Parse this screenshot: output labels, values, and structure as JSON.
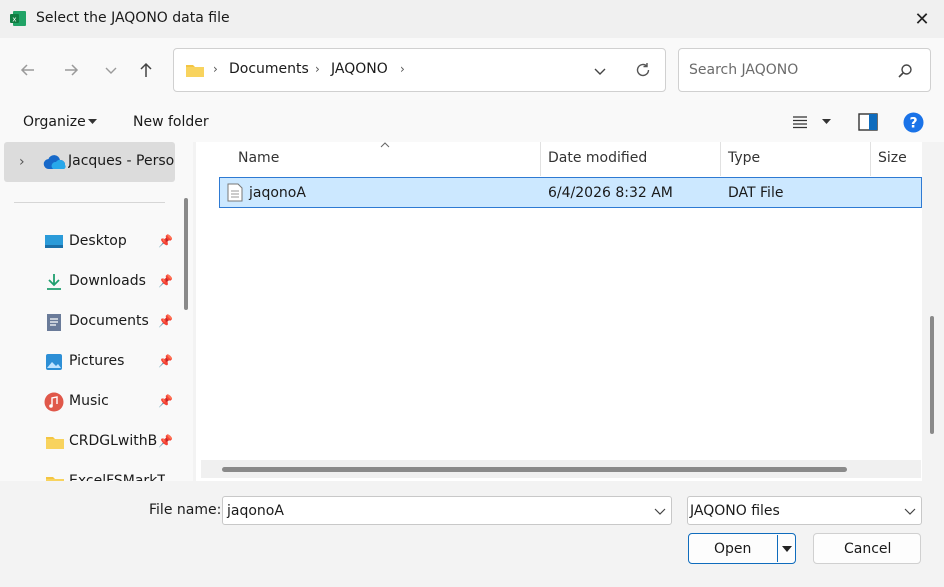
{
  "window": {
    "title": "Select the JAQONO data file",
    "close_symbol": "✕"
  },
  "nav": {
    "breadcrumbs": [
      "Documents",
      "JAQONO"
    ],
    "search_placeholder": "Search JAQONO"
  },
  "toolbar": {
    "organize_label": "Organize",
    "new_folder_label": "New folder"
  },
  "sidebar": {
    "onedrive_label": "Jacques - Personal",
    "items": [
      {
        "label": "Desktop",
        "icon": "desktop-icon",
        "color": "#2b9bd9"
      },
      {
        "label": "Downloads",
        "icon": "download-icon",
        "color": "#1f9f6e"
      },
      {
        "label": "Documents",
        "icon": "document-icon",
        "color": "#6a7b99"
      },
      {
        "label": "Pictures",
        "icon": "pictures-icon",
        "color": "#2d8fd6"
      },
      {
        "label": "Music",
        "icon": "music-icon",
        "color": "#e0584a"
      },
      {
        "label": "CRDGLwithBa",
        "icon": "folder-icon",
        "color": "#f4c542"
      },
      {
        "label": "ExcelFSMarkT",
        "icon": "folder-icon",
        "color": "#f4c542"
      }
    ]
  },
  "file_list": {
    "columns": [
      "Name",
      "Date modified",
      "Type",
      "Size"
    ],
    "rows": [
      {
        "name": "jaqonoA",
        "date_modified": "6/4/2026 8:32 AM",
        "type": "DAT File",
        "size": ""
      }
    ]
  },
  "footer": {
    "file_name_label": "File name:",
    "file_name_value": "jaqonoA",
    "filter_value": "JAQONO files",
    "open_label": "Open",
    "cancel_label": "Cancel"
  },
  "colors": {
    "accent": "#0f6cbd",
    "selection": "#cce8ff",
    "help": "#1a73e8"
  }
}
